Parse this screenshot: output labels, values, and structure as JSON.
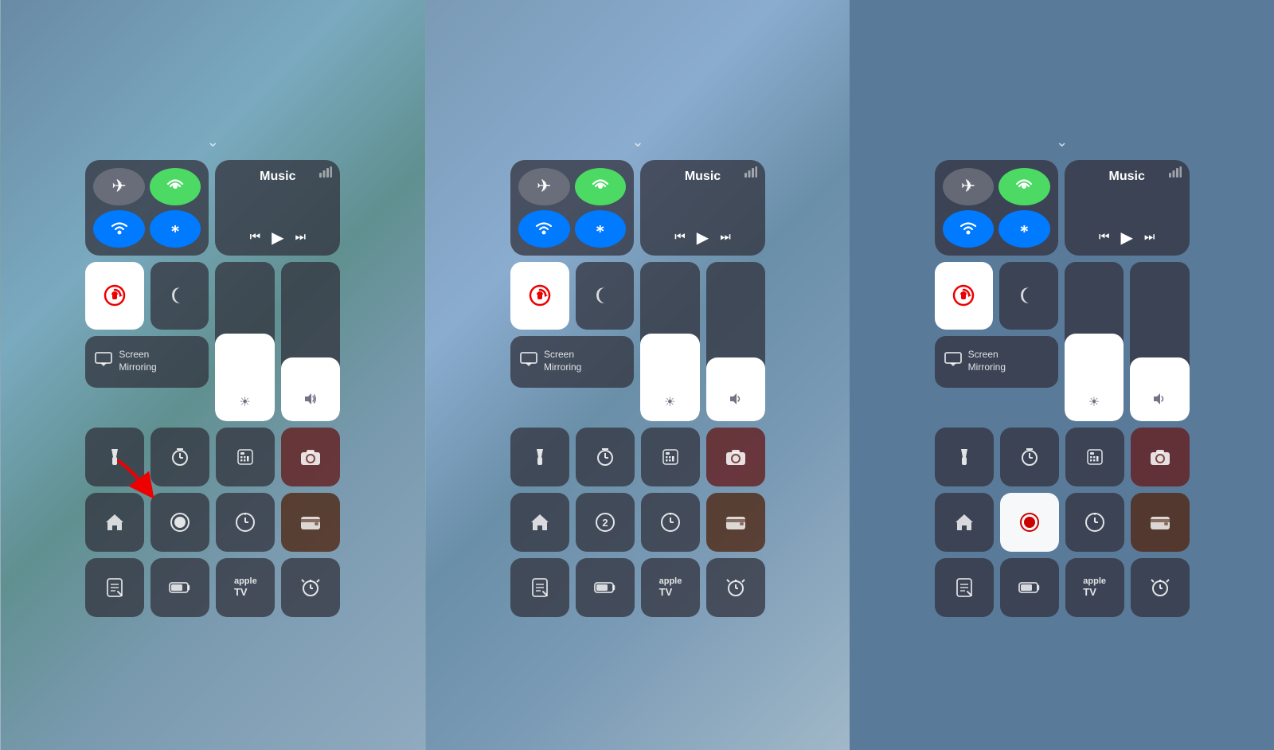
{
  "panels": [
    {
      "id": "panel-before",
      "chevron": "⌄",
      "connectivity": {
        "airplane": "✈",
        "cellular": "📶",
        "wifi": "wifi",
        "bluetooth": "bluetooth"
      },
      "music": {
        "title": "Music",
        "wifi_signal": "wifi",
        "controls": [
          "⏮",
          "▶",
          "⏭"
        ]
      },
      "lock_icon": "🔒",
      "night_icon": "🌙",
      "screen_mirroring": "Screen\nMirroring",
      "brightness_fill_pct": 55,
      "volume_fill_pct": 40,
      "icons": [
        {
          "icon": "🔦",
          "style": "normal"
        },
        {
          "icon": "⏱",
          "style": "normal"
        },
        {
          "icon": "🖩",
          "style": "normal"
        },
        {
          "icon": "📷",
          "style": "red-bg"
        },
        {
          "icon": "🏠",
          "style": "normal"
        },
        {
          "icon": "⏺",
          "style": "normal",
          "has_arrow": true
        },
        {
          "icon": "⏰",
          "style": "normal"
        },
        {
          "icon": "💳",
          "style": "normal"
        },
        {
          "icon": "✏",
          "style": "normal"
        },
        {
          "icon": "🔋",
          "style": "normal"
        },
        {
          "icon": "tv",
          "style": "normal"
        },
        {
          "icon": "⏰",
          "style": "normal"
        }
      ]
    },
    {
      "id": "panel-during",
      "chevron": "⌄",
      "brightness_fill_pct": 55,
      "volume_fill_pct": 40,
      "icons_row2": [
        {
          "icon": "🔦",
          "style": "normal"
        },
        {
          "icon": "⏱",
          "style": "normal"
        },
        {
          "icon": "🖩",
          "style": "normal"
        },
        {
          "icon": "📷",
          "style": "red-bg"
        },
        {
          "icon": "🏠",
          "style": "normal"
        },
        {
          "icon": "2",
          "style": "badge"
        },
        {
          "icon": "⏰",
          "style": "normal"
        },
        {
          "icon": "💳",
          "style": "normal"
        },
        {
          "icon": "✏",
          "style": "normal"
        },
        {
          "icon": "🔋",
          "style": "normal"
        },
        {
          "icon": "tv",
          "style": "normal"
        },
        {
          "icon": "⏰",
          "style": "normal"
        }
      ]
    },
    {
      "id": "panel-after",
      "chevron": "⌄",
      "brightness_fill_pct": 55,
      "volume_fill_pct": 40,
      "icons_row2": [
        {
          "icon": "🔦",
          "style": "normal"
        },
        {
          "icon": "⏱",
          "style": "normal"
        },
        {
          "icon": "🖩",
          "style": "normal"
        },
        {
          "icon": "📷",
          "style": "red-bg"
        },
        {
          "icon": "🏠",
          "style": "normal"
        },
        {
          "icon": "⏺",
          "style": "record-active"
        },
        {
          "icon": "⏰",
          "style": "normal"
        },
        {
          "icon": "💳",
          "style": "normal"
        },
        {
          "icon": "✏",
          "style": "normal"
        },
        {
          "icon": "🔋",
          "style": "normal"
        },
        {
          "icon": "tv",
          "style": "normal"
        },
        {
          "icon": "⏰",
          "style": "normal"
        }
      ]
    }
  ],
  "labels": {
    "music": "Music",
    "screen_mirroring": "Screen\nMirroring",
    "apple_tv": "appleTV",
    "brightness_icon": "☀",
    "volume_icon": "🔊"
  }
}
